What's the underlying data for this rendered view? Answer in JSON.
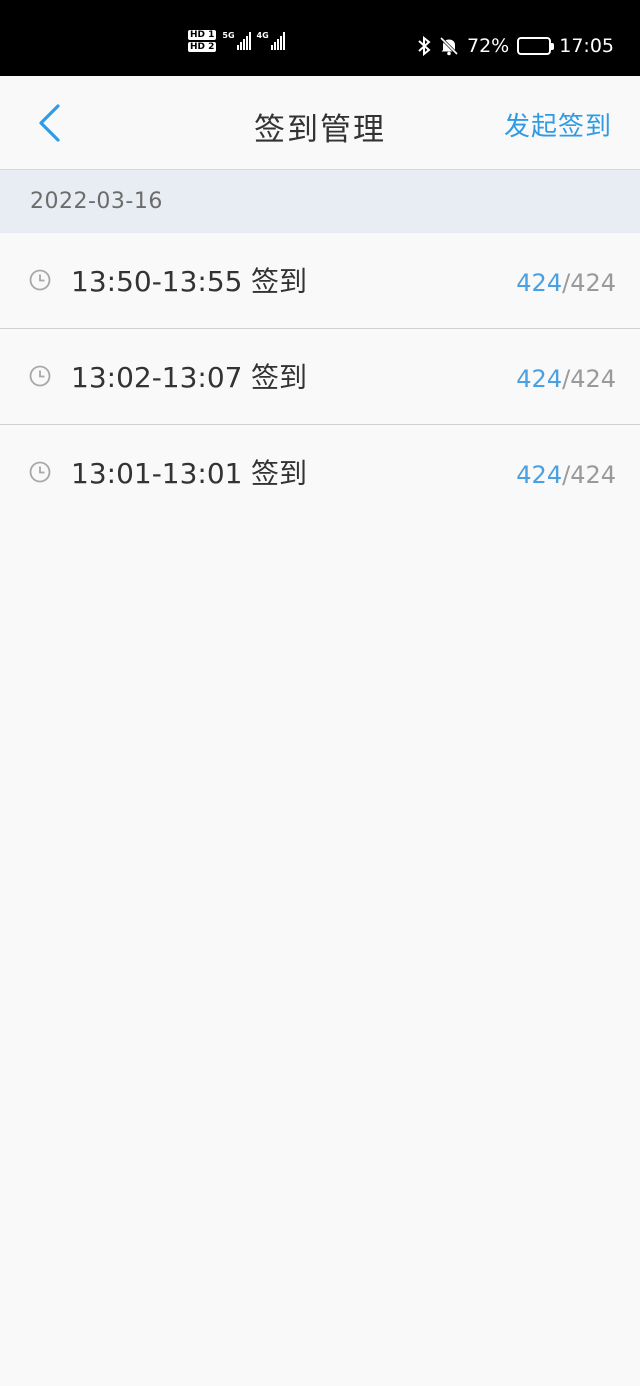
{
  "status_bar": {
    "sim1": "HD 1",
    "sim2": "HD 2",
    "net1": "5G",
    "net2": "4G",
    "battery_percent": "72%",
    "battery_level": 0.72,
    "time": "17:05"
  },
  "nav": {
    "title": "签到管理",
    "action": "发起签到"
  },
  "date_header": "2022-03-16",
  "sessions": [
    {
      "time": "13:50-13:55",
      "label": "签到",
      "signed": "424",
      "sep": "/",
      "total": "424"
    },
    {
      "time": "13:02-13:07",
      "label": "签到",
      "signed": "424",
      "sep": "/",
      "total": "424"
    },
    {
      "time": "13:01-13:01",
      "label": "签到",
      "signed": "424",
      "sep": "/",
      "total": "424"
    }
  ],
  "colors": {
    "accent": "#2f9be4",
    "count_signed": "#4aa0e0",
    "date_header_bg": "#e8edf3",
    "page_bg": "#f9f9f9"
  }
}
